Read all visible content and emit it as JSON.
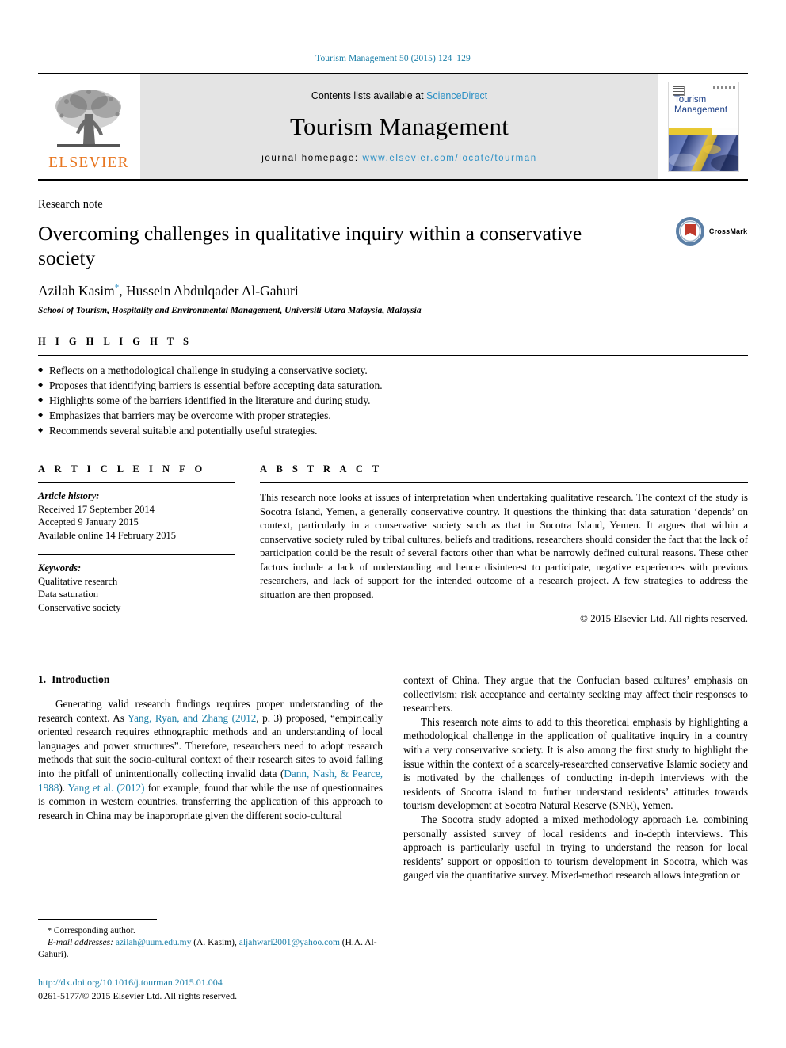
{
  "running_head": "Tourism Management 50 (2015) 124–129",
  "masthead": {
    "publisher_wordmark": "ELSEVIER",
    "contents_prefix": "Contents lists available at ",
    "contents_link": "ScienceDirect",
    "journal_name": "Tourism Management",
    "homepage_prefix": "journal homepage: ",
    "homepage_url": "www.elsevier.com/locate/tourman",
    "cover_title_line1": "Tourism",
    "cover_title_line2": "Management",
    "link_color": "#2a8fc4",
    "elsevier_orange": "#e87722"
  },
  "title_block": {
    "article_type": "Research note",
    "title": "Overcoming challenges in qualitative inquiry within a conservative society",
    "authors": "Azilah Kasim",
    "author_marker": "*",
    "authors_rest": ", Hussein Abdulqader Al-Gahuri",
    "affiliation": "School of Tourism, Hospitality and Environmental Management, Universiti Utara Malaysia, Malaysia",
    "crossmark_label": "CrossMark"
  },
  "highlights": {
    "heading": "H I G H L I G H T S",
    "items": [
      "Reflects on a methodological challenge in studying a conservative society.",
      "Proposes that identifying barriers is essential before accepting data saturation.",
      "Highlights some of the barriers identified in the literature and during study.",
      "Emphasizes that barriers may be overcome with proper strategies.",
      "Recommends several suitable and potentially useful strategies."
    ]
  },
  "article_info": {
    "heading": "A R T I C L E  I N F O",
    "history_label": "Article history:",
    "history": [
      "Received 17 September 2014",
      "Accepted 9 January 2015",
      "Available online 14 February 2015"
    ],
    "keywords_label": "Keywords:",
    "keywords": [
      "Qualitative research",
      "Data saturation",
      "Conservative society"
    ]
  },
  "abstract": {
    "heading": "A B S T R A C T",
    "text": "This research note looks at issues of interpretation when undertaking qualitative research. The context of the study is Socotra Island, Yemen, a generally conservative country. It questions the thinking that data saturation ‘depends’ on context, particularly in a conservative society such as that in Socotra Island, Yemen. It argues that within a conservative society ruled by tribal cultures, beliefs and traditions, researchers should consider the fact that the lack of participation could be the result of several factors other than what be narrowly defined cultural reasons. These other factors include a lack of understanding and hence disinterest to participate, negative experiences with previous researchers, and lack of support for the intended outcome of a research project. A few strategies to address the situation are then proposed.",
    "copyright": "© 2015 Elsevier Ltd. All rights reserved."
  },
  "body": {
    "section_number": "1.",
    "section_title": "Introduction",
    "left_para_1_a": "Generating valid research findings requires proper understanding of the research context. As ",
    "left_ref_1": "Yang, Ryan, and Zhang (2012",
    "left_para_1_b": ", p. 3) proposed, “empirically oriented research requires ethnographic methods and an understanding of local languages and power structures”. Therefore, researchers need to adopt research methods that suit the socio-cultural context of their research sites to avoid falling into the pitfall of unintentionally collecting invalid data (",
    "left_ref_2": "Dann, Nash, & Pearce, 1988",
    "left_para_1_c": "). ",
    "left_ref_3": "Yang et al. (2012)",
    "left_para_1_d": " for example, found that while the use of questionnaires is common in western countries, transferring the application of this approach to research in China may be inappropriate given the different socio-cultural",
    "right_para_1": "context of China. They argue that the Confucian based cultures’ emphasis on collectivism; risk acceptance and certainty seeking may affect their responses to researchers.",
    "right_para_2": "This research note aims to add to this theoretical emphasis by highlighting a methodological challenge in the application of qualitative inquiry in a country with a very conservative society. It is also among the first study to highlight the issue within the context of a scarcely-researched conservative Islamic society and is motivated by the challenges of conducting in-depth interviews with the residents of Socotra island to further understand residents’ attitudes towards tourism development at Socotra Natural Reserve (SNR), Yemen.",
    "right_para_3": "The Socotra study adopted a mixed methodology approach i.e. combining personally assisted survey of local residents and in-depth interviews. This approach is particularly useful in trying to understand the reason for local residents’ support or opposition to tourism development in Socotra, which was gauged via the quantitative survey. Mixed-method research allows integration or"
  },
  "footnotes": {
    "corresponding_marker": "*",
    "corresponding_text": "Corresponding author.",
    "email_label": "E-mail addresses:",
    "email_1": "azilah@uum.edu.my",
    "email_1_owner": "(A. Kasim),",
    "email_2": "aljahwari2001@yahoo.com",
    "email_2_owner": "(H.A. Al-Gahuri).",
    "doi": "http://dx.doi.org/10.1016/j.tourman.2015.01.004",
    "issn_copyright": "0261-5177/© 2015 Elsevier Ltd. All rights reserved."
  }
}
